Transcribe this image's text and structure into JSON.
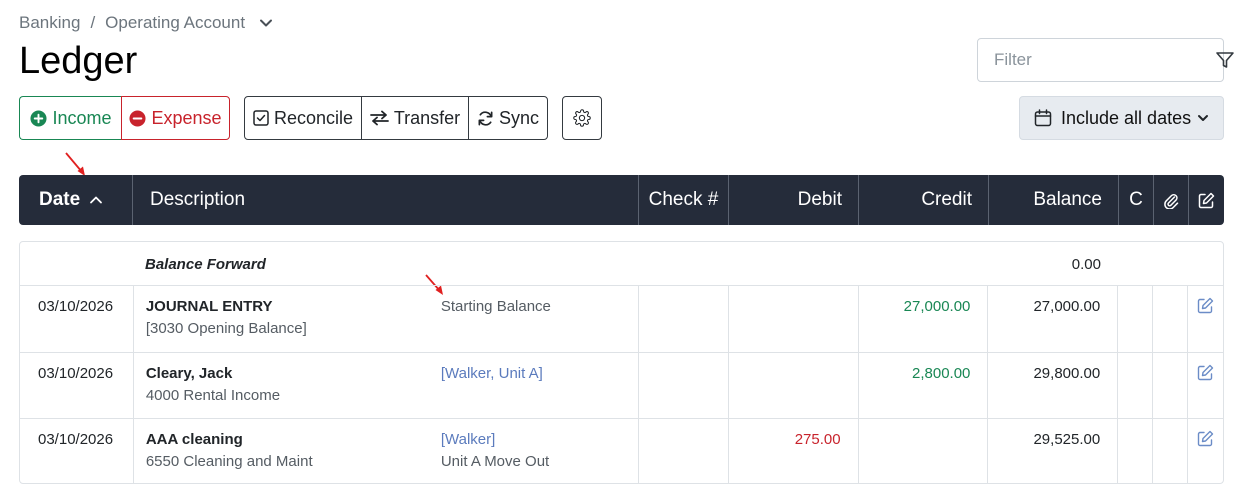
{
  "breadcrumb": {
    "root": "Banking",
    "separator": "/",
    "current": "Operating Account"
  },
  "page": {
    "title": "Ledger"
  },
  "filter": {
    "placeholder": "Filter"
  },
  "toolbar": {
    "income": "Income",
    "expense": "Expense",
    "reconcile": "Reconcile",
    "transfer": "Transfer",
    "sync": "Sync"
  },
  "date_range": {
    "label": "Include all dates"
  },
  "table": {
    "headers": {
      "date": "Date",
      "description": "Description",
      "check": "Check #",
      "debit": "Debit",
      "credit": "Credit",
      "balance": "Balance",
      "c": "C"
    },
    "balance_forward": {
      "label": "Balance Forward",
      "balance": "0.00"
    },
    "rows": [
      {
        "date": "03/10/2026",
        "payee": "JOURNAL ENTRY",
        "account": "[3030 Opening Balance]",
        "memo_link_open": "",
        "memo_link": "",
        "memo_link_close": "",
        "memo": "Starting Balance",
        "check": "",
        "debit": "",
        "credit": "27,000.00",
        "balance": "27,000.00"
      },
      {
        "date": "03/10/2026",
        "payee": "Cleary, Jack",
        "account": "4000 Rental Income",
        "memo_link_open": "[",
        "memo_link": "Walker, Unit A",
        "memo_link_close": "]",
        "memo": "",
        "check": "",
        "debit": "",
        "credit": "2,800.00",
        "balance": "29,800.00"
      },
      {
        "date": "03/10/2026",
        "payee": "AAA cleaning",
        "account": "6550 Cleaning and Maint",
        "memo_link_open": "[",
        "memo_link": "Walker",
        "memo_link_close": "]",
        "memo": "Unit A Move Out",
        "check": "",
        "debit": "275.00",
        "credit": "",
        "balance": "29,525.00"
      }
    ]
  },
  "colors": {
    "header_bg": "#252c3a",
    "income": "#198754",
    "expense": "#c8232c",
    "credit": "#198754",
    "debit": "#c8232c",
    "link": "#5b7bbd",
    "annotation_arrow": "#e02020"
  },
  "icons": {
    "breadcrumb_dropdown": "chevron-down-icon",
    "filter": "funnel-icon",
    "income": "plus-circle-icon",
    "expense": "minus-circle-icon",
    "reconcile": "check-square-icon",
    "transfer": "arrows-left-right-icon",
    "sync": "refresh-icon",
    "settings": "gear-icon",
    "calendar": "calendar-icon",
    "sort": "chevron-up-icon",
    "attachment": "paperclip-icon",
    "edit": "edit-icon"
  }
}
